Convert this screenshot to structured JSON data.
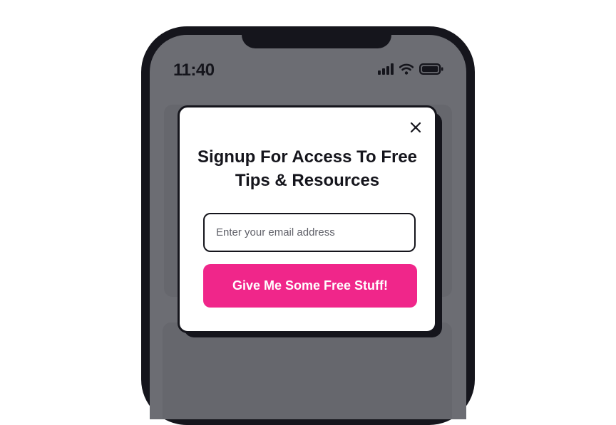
{
  "status_bar": {
    "time": "11:40",
    "icons": [
      "signal-icon",
      "wifi-icon",
      "battery-icon"
    ]
  },
  "popup": {
    "title_line1": "Signup For Access To Free",
    "title_line2": "Tips & Resources",
    "email_placeholder": "Enter your email address",
    "email_value": "",
    "cta_label": "Give Me Some Free Stuff!",
    "close_icon": "close-icon"
  },
  "colors": {
    "accent": "#f0268a",
    "dark": "#15151c",
    "screen_overlay": "#6c6d73"
  }
}
